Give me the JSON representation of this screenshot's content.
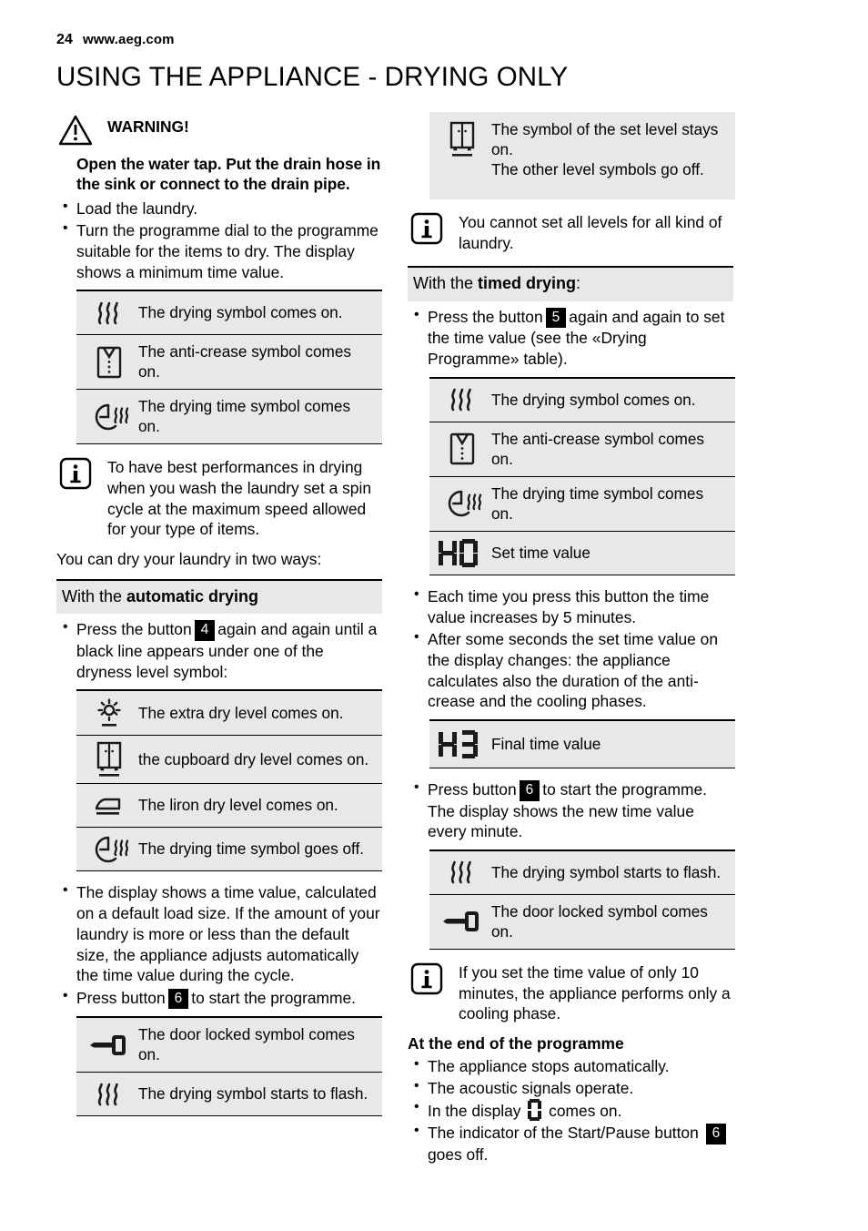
{
  "header": {
    "page_number": "24",
    "website": "www.aeg.com",
    "chapter_title": "USING THE APPLIANCE - DRYING ONLY"
  },
  "left": {
    "warning_label": "WARNING!",
    "warning_icon": "warning-triangle-icon",
    "lead_bold": "Open the water tap. Put the drain hose in the sink or connect to the drain pipe.",
    "bullets_1": [
      "Load the laundry.",
      "Turn the programme dial to the programme suitable for the items to dry. The display shows a minimum time value."
    ],
    "table_1": [
      {
        "icon": "drying-steam-icon",
        "text": "The drying symbol comes on."
      },
      {
        "icon": "anti-crease-shirt-icon",
        "text": "The anti-crease symbol comes on."
      },
      {
        "icon": "drying-time-clock-icon",
        "text": "The drying time symbol comes on."
      }
    ],
    "info_1": {
      "icon": "info-icon",
      "text": "To have best performances in drying when you wash the laundry set a spin cycle at the maximum speed allowed for your type of items."
    },
    "intro_two_ways": "You can dry your laundry in two ways:",
    "band_automatic_prefix": "With the ",
    "band_automatic_bold": "automatic drying",
    "bullet_press_4": {
      "before": "Press the button",
      "badge": "4",
      "after": "again and again until a black line appears under one of the dryness level symbol:"
    },
    "table_2": [
      {
        "icon": "extra-dry-sun-icon",
        "text": "The extra dry level comes on."
      },
      {
        "icon": "cupboard-dry-icon",
        "text": "the cupboard dry level comes on."
      },
      {
        "icon": "iron-dry-icon",
        "text": "The liron dry level comes on."
      },
      {
        "icon": "drying-time-clock-icon",
        "text": "The drying time symbol goes off."
      }
    ],
    "bullet_display_time": "The display shows a time value, calculated on a default load size. If the amount of your laundry is more or less than the default size, the appliance adjusts automatically the time value during the cycle.",
    "bullet_press_6": {
      "before": "Press button",
      "badge": "6",
      "after": "to start the programme."
    },
    "table_3": [
      {
        "icon": "door-locked-key-icon",
        "text": "The door locked symbol comes on."
      },
      {
        "icon": "drying-steam-icon",
        "text": "The drying symbol starts to flash."
      }
    ]
  },
  "right": {
    "table_top": [
      {
        "icon": "cupboard-dry-icon",
        "text": "The symbol of the set level stays on.\nThe other level symbols go off."
      }
    ],
    "info_levels": {
      "icon": "info-icon",
      "text": "You cannot set all levels for all kind of laundry."
    },
    "band_timed_prefix": "With the ",
    "band_timed_bold": "timed drying",
    "band_timed_suffix": ":",
    "bullet_press_5": {
      "before": "Press the button",
      "badge": "5",
      "after": "again and again to set the time value (see the «Drying Programme» table)."
    },
    "table_4": [
      {
        "icon": "drying-steam-icon",
        "text": "The drying symbol comes on."
      },
      {
        "icon": "anti-crease-shirt-icon",
        "text": "The anti-crease symbol comes on."
      },
      {
        "icon": "drying-time-clock-icon",
        "text": "The drying time symbol comes on."
      },
      {
        "icon": "seven-segment-display",
        "display_value": "40",
        "text": "Set time value"
      }
    ],
    "bullets_mid": [
      "Each time you press this button the time value increases by 5 minutes.",
      "After some seconds the set time value on the display changes: the appliance calculates also the duration of the anti-crease and the cooling phases."
    ],
    "table_final": [
      {
        "icon": "seven-segment-display",
        "display_value": "43",
        "text": "Final time value"
      }
    ],
    "bullet_press_6": {
      "before": "Press button",
      "badge": "6",
      "after": "to start the programme. The display shows the new time value every minute."
    },
    "table_5": [
      {
        "icon": "drying-steam-icon",
        "text": "The drying symbol starts to flash."
      },
      {
        "icon": "door-locked-key-icon",
        "text": "The door locked symbol comes on."
      }
    ],
    "info_ten_minutes": {
      "icon": "info-icon",
      "text": "If you set the time value of only 10 minutes, the appliance performs only a cooling phase."
    },
    "end_heading": "At the end of the programme",
    "end_bullets": [
      "The appliance stops automatically.",
      "The acoustic signals operate."
    ],
    "bullet_display_zero": {
      "before": "In the display",
      "display_value": "0",
      "after": "comes on."
    },
    "bullet_indicator": {
      "before": "The indicator of the Start/Pause button",
      "badge": "6",
      "after": "goes off."
    }
  },
  "colors": {
    "table_background": "#e8e8e8",
    "rule": "#000000",
    "badge_background": "#000000",
    "badge_text": "#ffffff"
  }
}
